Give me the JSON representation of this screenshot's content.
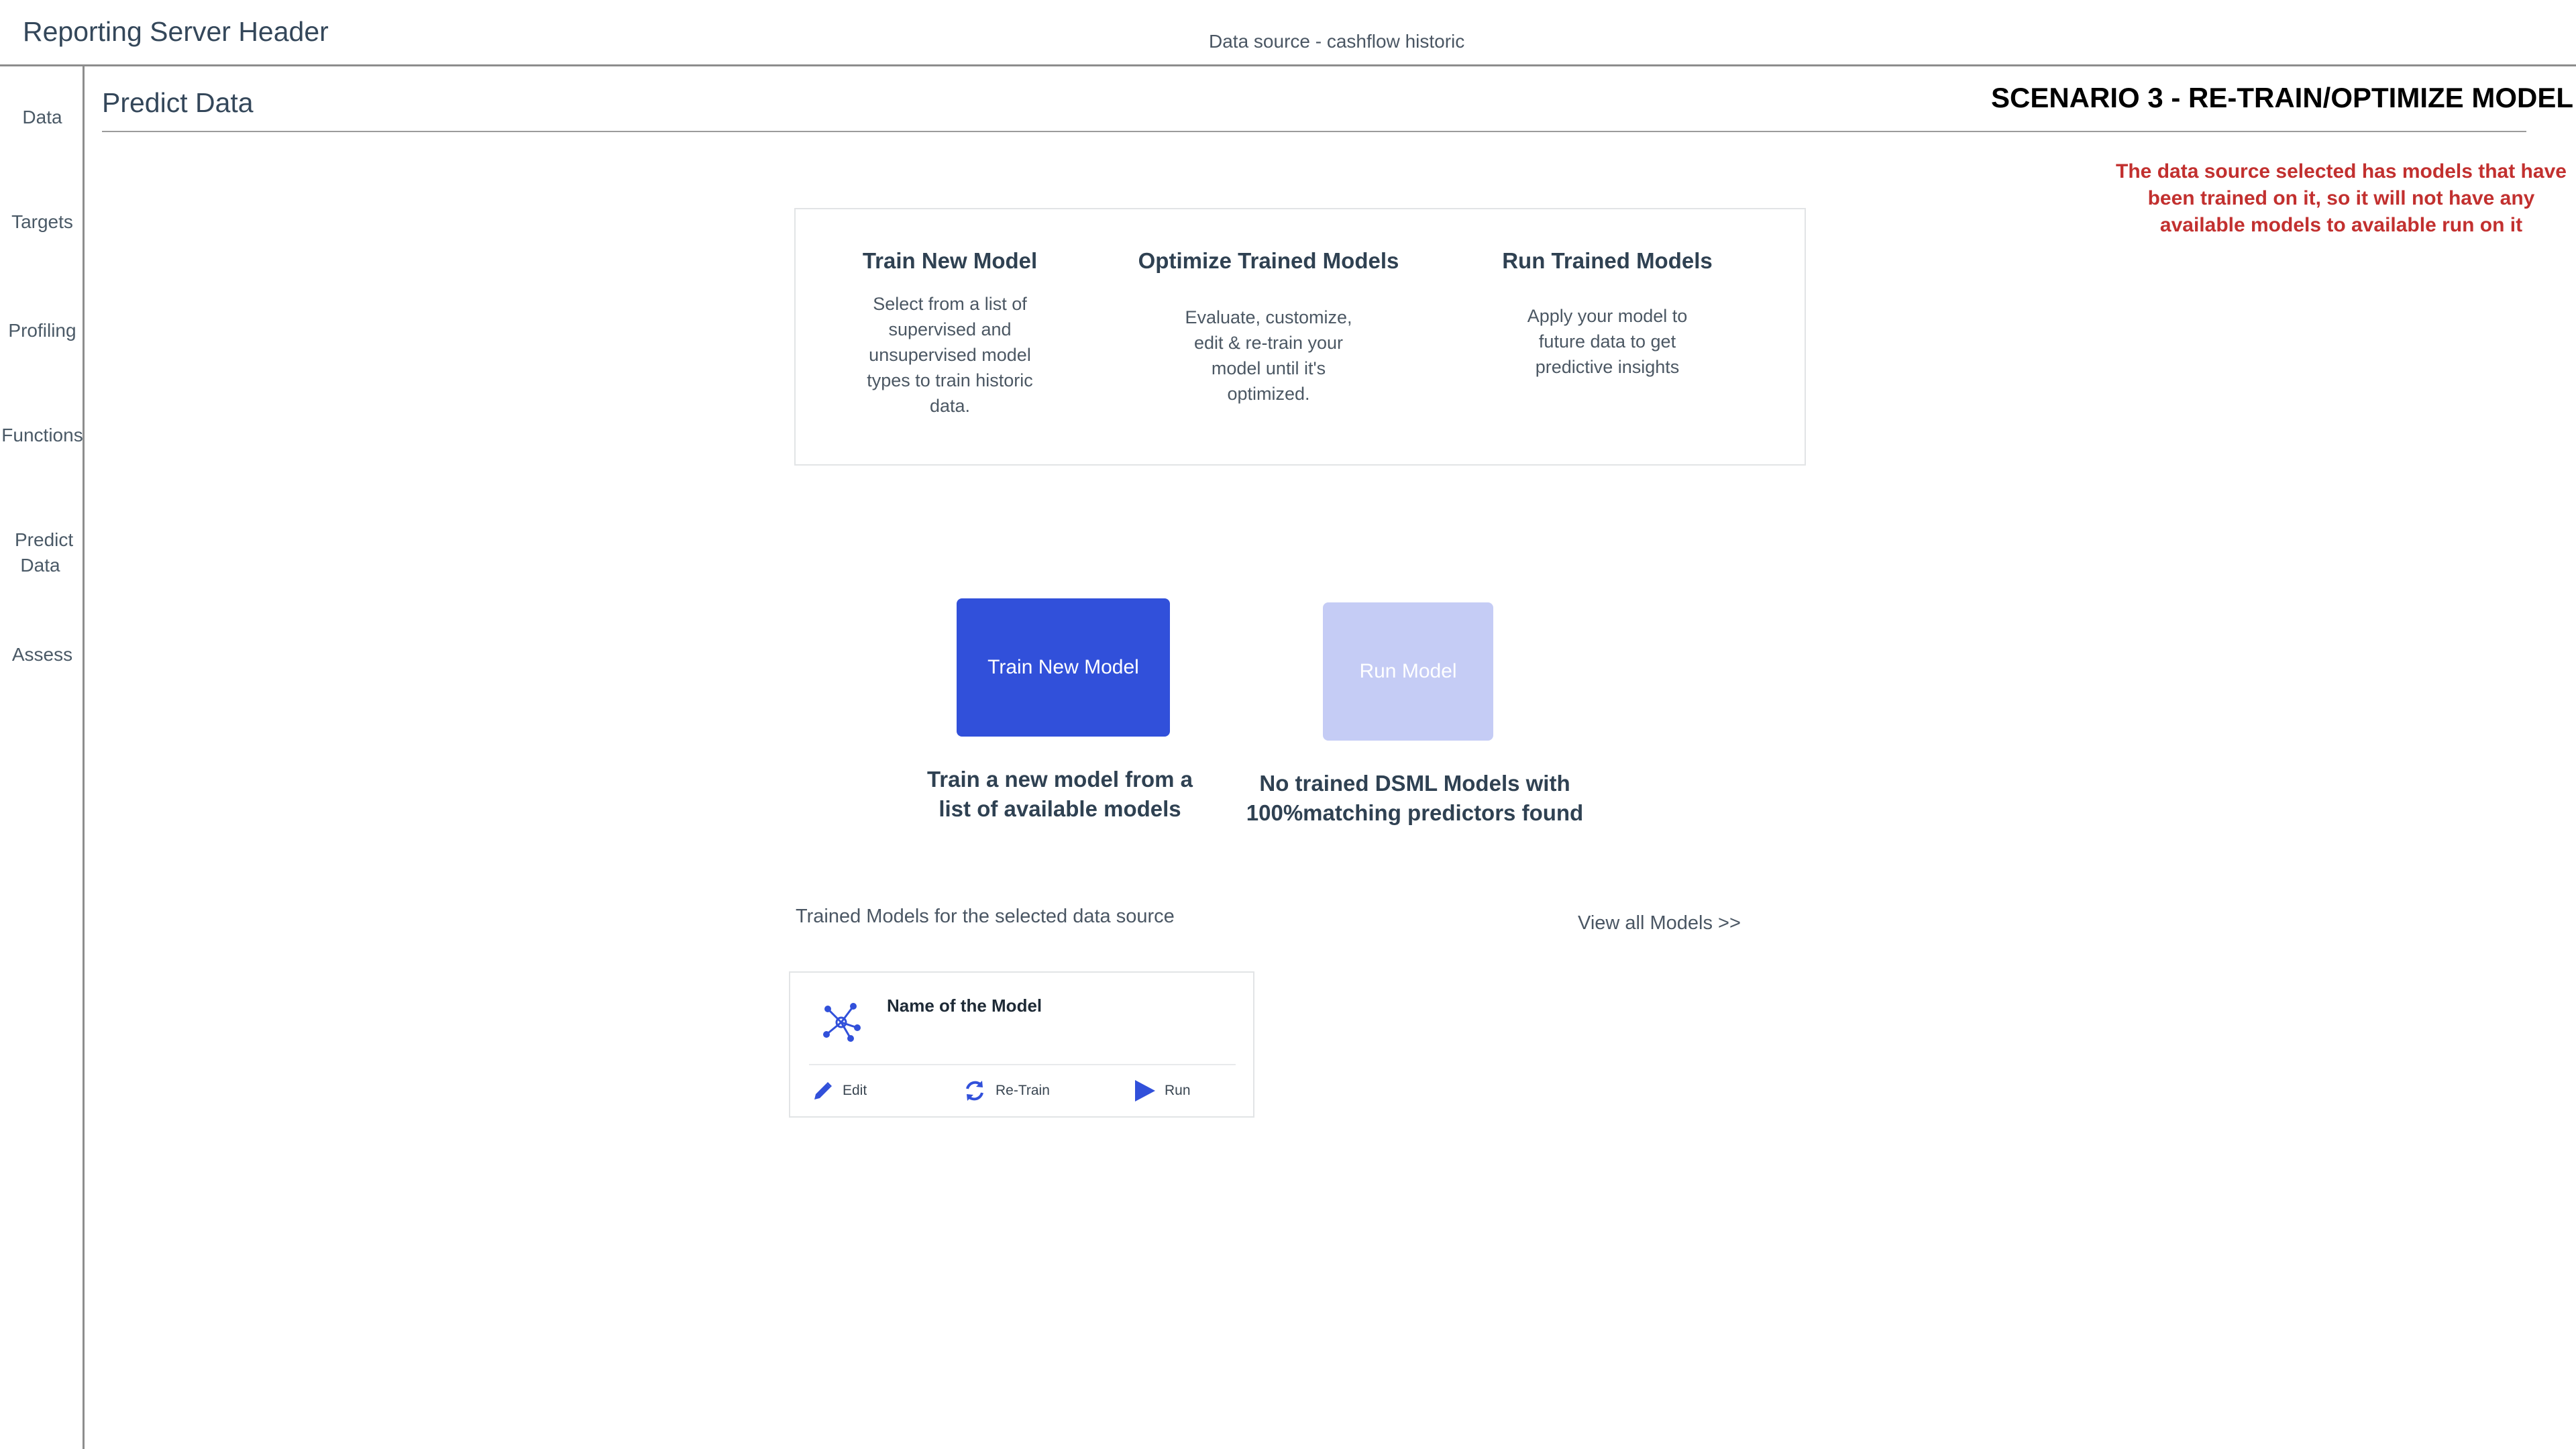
{
  "header": {
    "app_title": "Reporting Server Header",
    "data_source": "Data source - cashflow historic"
  },
  "sidebar": {
    "items": [
      {
        "label": "Data"
      },
      {
        "label": "Targets"
      },
      {
        "label": "Profiling"
      },
      {
        "label": "Functions"
      },
      {
        "label": "Predict Data"
      },
      {
        "label": "Assess"
      }
    ]
  },
  "page": {
    "title": "Predict Data",
    "scenario_title": "SCENARIO 3 - RE-TRAIN/OPTIMIZE MODEL",
    "scenario_note": "The data source selected has models that have been trained on it, so it will not have any available models to available run on it"
  },
  "info_card": {
    "columns": [
      {
        "title": "Train New Model",
        "description": "Select from a list of supervised and unsupervised model types to train historic data."
      },
      {
        "title": "Optimize Trained Models",
        "description": "Evaluate, customize, edit & re-train your model until it's optimized."
      },
      {
        "title": "Run Trained Models",
        "description": "Apply your model to future data to get predictive insights"
      }
    ]
  },
  "actions": {
    "train_button_label": "Train New Model",
    "train_caption": "Train a new model from a list of available models",
    "run_button_label": "Run Model",
    "run_caption": "No trained DSML Models with 100%matching predictors found"
  },
  "models": {
    "section_label": "Trained Models for the selected data source",
    "view_all_label": "View all Models >>",
    "card": {
      "name": "Name of the Model",
      "icon": "network-icon",
      "edit_label": "Edit",
      "retrain_label": "Re-Train",
      "run_label": "Run"
    }
  },
  "colors": {
    "primary": "#3150da",
    "primary_disabled": "#c5ccf5",
    "warning_text": "#c2302f",
    "text_dark": "#2f4152"
  }
}
